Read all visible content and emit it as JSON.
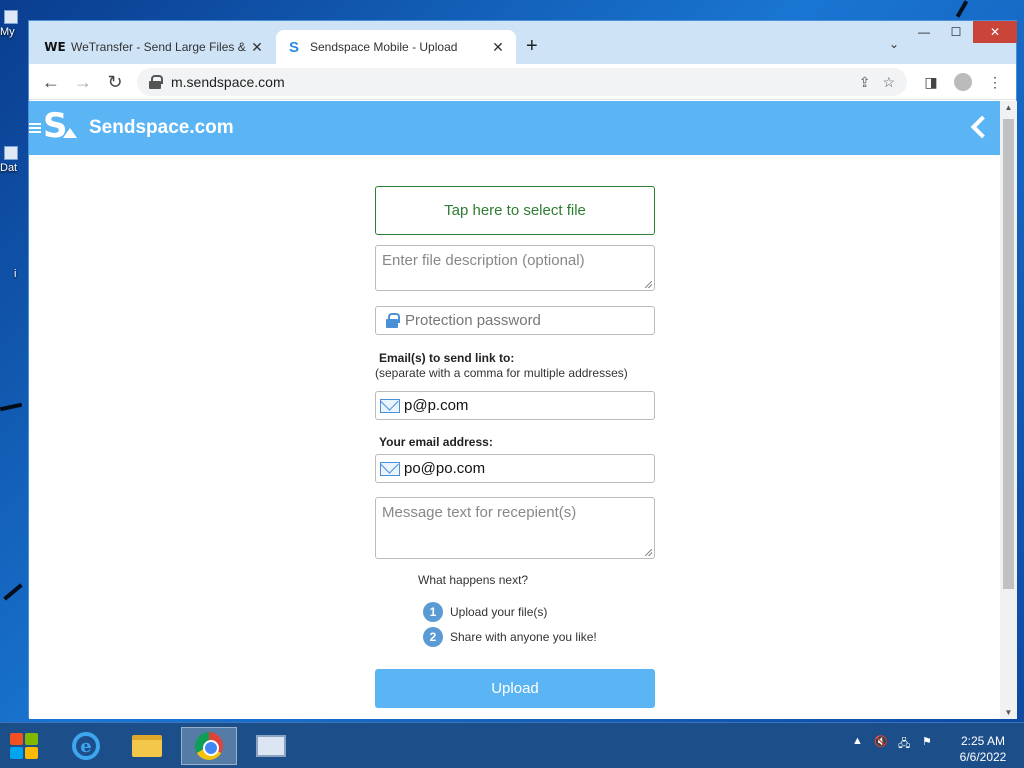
{
  "desktop": {
    "icons": [
      {
        "label": "My"
      },
      {
        "label": "Dat"
      },
      {
        "label": "i"
      }
    ]
  },
  "browser": {
    "tabs": [
      {
        "title": "WeTransfer - Send Large Files &",
        "favicon": "WE",
        "close": "✕"
      },
      {
        "title": "Sendspace Mobile - Upload",
        "favicon": "S",
        "close": "✕"
      }
    ],
    "new_tab": "+",
    "tab_list": "⌄",
    "window_controls": {
      "minimize": "—",
      "maximize": "☐",
      "close": "✕"
    },
    "nav": {
      "back": "←",
      "forward": "→",
      "reload": "↻"
    },
    "url": "m.sendspace.com"
  },
  "site": {
    "brand": "Sendspace.com",
    "logo_letter": "S"
  },
  "form": {
    "select_file_label": "Tap here to select file",
    "description_placeholder": "Enter file description (optional)",
    "password_placeholder": "Protection password",
    "emails_label": "Email(s) to send link to:",
    "emails_hint": "(separate with a comma for multiple addresses)",
    "recipient_email": "p@p.com",
    "your_email_label": "Your email address:",
    "your_email": "po@po.com",
    "message_placeholder": "Message text for recepient(s)",
    "next_title": "What happens next?",
    "steps": [
      {
        "num": "1",
        "text": "Upload your file(s)"
      },
      {
        "num": "2",
        "text": "Share with anyone you like!"
      }
    ],
    "upload_label": "Upload"
  },
  "taskbar": {
    "time": "2:25 AM",
    "date": "6/6/2022",
    "apps": [
      "internet-explorer",
      "file-explorer",
      "chrome",
      "monitor"
    ]
  },
  "colors": {
    "header": "#5bb5f5",
    "select_border": "#2e7d32",
    "upload_button": "#5bb5f5",
    "step_badge": "#5b9bd5"
  }
}
